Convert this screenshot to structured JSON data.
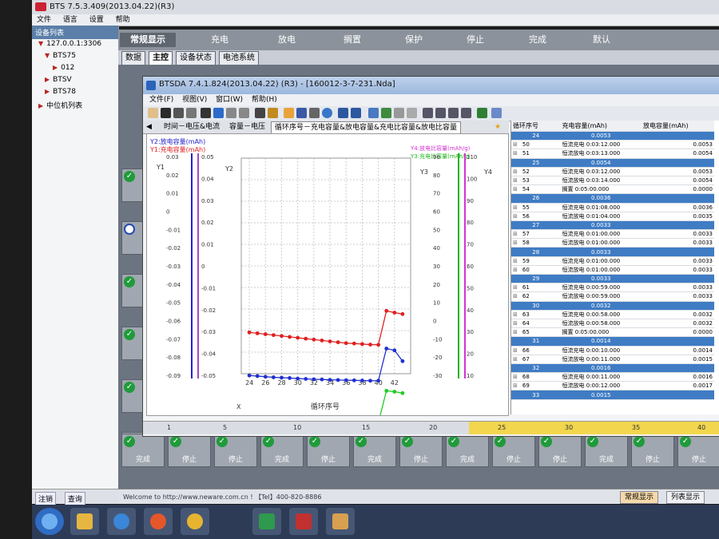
{
  "app": {
    "title": "BTS 7.5.3.409(2013.04.22)(R3)",
    "menu": [
      "文件",
      "语言",
      "设置",
      "帮助"
    ],
    "tree_header": "设备列表",
    "tree": [
      {
        "label": "127.0.0.1:3306",
        "level": 0
      },
      {
        "label": "BTS75",
        "level": 1
      },
      {
        "label": "012",
        "level": 2
      },
      {
        "label": "BTSV",
        "level": 1
      },
      {
        "label": "BTS78",
        "level": 1
      },
      {
        "label": "中位机列表",
        "level": 0
      }
    ],
    "tree_buttons": [
      "注销",
      "查询"
    ],
    "top_tabs": [
      "常规显示",
      "充电",
      "放电",
      "搁置",
      "保护",
      "停止",
      "完成",
      "默认"
    ],
    "sub_tabs": [
      "数据",
      "主控",
      "设备状态",
      "电池系统"
    ],
    "channel_labels": [
      "完成",
      "停止",
      "停止",
      "完成",
      "停止",
      "完成",
      "停止",
      "完成",
      "停止",
      "停止",
      "完成",
      "停止",
      "停止"
    ],
    "status_welcome": "Welcome to http://www.neware.com.cn ! 【Tel】400-820-8886",
    "status_buttons": [
      "常规显示",
      "列表显示"
    ]
  },
  "btsda": {
    "title": "BTSDA 7.4.1.824(2013.04.22) (R3) - [160012-3-7-231.Nda]",
    "menu": [
      "文件(F)",
      "视图(V)",
      "窗口(W)",
      "帮助(H)"
    ],
    "tabs": [
      "时间－电压&电流",
      "容量－电压",
      "循环序号－充电容量&放电容量&充电比容量&放电比容量"
    ],
    "bottom_ticks": [
      "1",
      "5",
      "10",
      "15",
      "20",
      "25",
      "30",
      "35",
      "40"
    ]
  },
  "chart_data": {
    "type": "line",
    "legend_left": [
      "Y2:放电容量(mAh)",
      "Y1:充电容量(mAh)"
    ],
    "legend_right": [
      "Y4:放电比容量(mAh/g)",
      "Y3:充电比容量(mAh/g)"
    ],
    "xlabel": "循环序号",
    "x_axis_letter": "X",
    "axis_names": {
      "y1": "Y1",
      "y2": "Y2",
      "y3": "Y3",
      "y4": "Y4"
    },
    "xlim": [
      23,
      44
    ],
    "x_ticks": [
      24,
      26,
      28,
      30,
      32,
      34,
      36,
      38,
      40,
      42
    ],
    "y1": {
      "ticks": [
        "0.03",
        "0.02",
        "0.01",
        "0",
        "-0.01",
        "-0.02",
        "-0.03",
        "-0.04",
        "-0.05",
        "-0.06",
        "-0.07",
        "-0.08",
        "-0.09"
      ],
      "color": "#2222cc"
    },
    "y2": {
      "ticks": [
        "0.05",
        "0.04",
        "0.03",
        "0.02",
        "0.01",
        "0",
        "-0.01",
        "-0.02",
        "-0.03",
        "-0.04",
        "-0.05"
      ],
      "color": "#a646c9"
    },
    "y3": {
      "ticks": [
        "90",
        "80",
        "70",
        "60",
        "50",
        "40",
        "30",
        "20",
        "10",
        "0",
        "-10",
        "-20",
        "-30"
      ],
      "color": "#1bb51b"
    },
    "y4": {
      "ticks": [
        "110",
        "100",
        "90",
        "80",
        "70",
        "60",
        "50",
        "40",
        "30",
        "20",
        "10"
      ],
      "color": "#d233d2"
    },
    "x": [
      24,
      25,
      26,
      27,
      28,
      29,
      30,
      31,
      32,
      33,
      34,
      35,
      36,
      37,
      38,
      39,
      40,
      41,
      42,
      43
    ],
    "series": [
      {
        "color": "#e02020",
        "values": [
          -7,
          -7.5,
          -8,
          -8.5,
          -9,
          -9.5,
          -10,
          -10.5,
          -11,
          -11.5,
          -12,
          -12.5,
          -13,
          -13.2,
          -13.5,
          -13.8,
          -13.9,
          5,
          4,
          3.2
        ]
      },
      {
        "color": "#2030d0",
        "values": [
          -31,
          -31.3,
          -31.7,
          -32,
          -32.2,
          -32.4,
          -32.7,
          -32.9,
          -33.1,
          -33.2,
          -33.4,
          -33.5,
          -33.6,
          -33.7,
          -33.8,
          -33.9,
          -33.9,
          -16,
          -17,
          -23
        ]
      },
      {
        "color": "#22cc22",
        "values": [
          -55,
          -55.3,
          -55.6,
          -55.9,
          -56.1,
          -56.2,
          -56.4,
          -56.5,
          -56.6,
          -56.7,
          -56.8,
          -56.9,
          -57,
          -57,
          -57.1,
          -57.2,
          -57.2,
          -39.5,
          -40,
          -40.8
        ]
      },
      {
        "color": "#e040d0",
        "values": [
          -79,
          -79.5,
          -79.9,
          -80.1,
          -80.3,
          -80.5,
          -80.7,
          -80.9,
          -81,
          -81.1,
          -81.2,
          -81.3,
          -81.4,
          -81.5,
          -81.6,
          -81.6,
          -81.7,
          -62,
          -63.5,
          -70
        ]
      }
    ]
  },
  "grid": {
    "headers": [
      "循环序号",
      "充电容量(mAh)",
      "放电容量(mAh)"
    ],
    "rows": [
      {
        "type": "group",
        "id": "24",
        "value": "0.0053"
      },
      {
        "type": "row",
        "n": "50",
        "step": "恒流充电",
        "time": "0:03:12.000",
        "val": "0.0053"
      },
      {
        "type": "row",
        "n": "51",
        "step": "恒流放电",
        "time": "0:03:13.000",
        "val": "0.0054"
      },
      {
        "type": "group",
        "id": "25",
        "value": "0.0054"
      },
      {
        "type": "row",
        "n": "52",
        "step": "恒流充电",
        "time": "0:03:12.000",
        "val": "0.0053"
      },
      {
        "type": "row",
        "n": "53",
        "step": "恒流放电",
        "time": "0:03:14.000",
        "val": "0.0054"
      },
      {
        "type": "row",
        "n": "54",
        "step": "搁置",
        "time": "0:05:00.000",
        "val": "0.0000"
      },
      {
        "type": "group",
        "id": "26",
        "value": "0.0036"
      },
      {
        "type": "row",
        "n": "55",
        "step": "恒流充电",
        "time": "0:01:08.000",
        "val": "0.0036"
      },
      {
        "type": "row",
        "n": "56",
        "step": "恒流放电",
        "time": "0:01:04.000",
        "val": "0.0035"
      },
      {
        "type": "group",
        "id": "27",
        "value": "0.0033"
      },
      {
        "type": "row",
        "n": "57",
        "step": "恒流充电",
        "time": "0:01:00.000",
        "val": "0.0033"
      },
      {
        "type": "row",
        "n": "58",
        "step": "恒流放电",
        "time": "0:01:00.000",
        "val": "0.0033"
      },
      {
        "type": "group",
        "id": "28",
        "value": "0.0033"
      },
      {
        "type": "row",
        "n": "59",
        "step": "恒流充电",
        "time": "0:01:00.000",
        "val": "0.0033"
      },
      {
        "type": "row",
        "n": "60",
        "step": "恒流放电",
        "time": "0:01:00.000",
        "val": "0.0033"
      },
      {
        "type": "group",
        "id": "29",
        "value": "0.0033"
      },
      {
        "type": "row",
        "n": "61",
        "step": "恒流充电",
        "time": "0:00:59.000",
        "val": "0.0033"
      },
      {
        "type": "row",
        "n": "62",
        "step": "恒流放电",
        "time": "0:00:59.000",
        "val": "0.0033"
      },
      {
        "type": "group",
        "id": "30",
        "value": "0.0032"
      },
      {
        "type": "row",
        "n": "63",
        "step": "恒流充电",
        "time": "0:00:58.000",
        "val": "0.0032"
      },
      {
        "type": "row",
        "n": "64",
        "step": "恒流放电",
        "time": "0:00:58.000",
        "val": "0.0032"
      },
      {
        "type": "row",
        "n": "65",
        "step": "搁置",
        "time": "0:05:00.000",
        "val": "0.0000"
      },
      {
        "type": "group",
        "id": "31",
        "value": "0.0014"
      },
      {
        "type": "row",
        "n": "66",
        "step": "恒流充电",
        "time": "0:00:10.000",
        "val": "0.0014"
      },
      {
        "type": "row",
        "n": "67",
        "step": "恒流放电",
        "time": "0:00:11.000",
        "val": "0.0015"
      },
      {
        "type": "group",
        "id": "32",
        "value": "0.0016"
      },
      {
        "type": "row",
        "n": "68",
        "step": "恒流充电",
        "time": "0:00:11.000",
        "val": "0.0016"
      },
      {
        "type": "row",
        "n": "69",
        "step": "恒流放电",
        "time": "0:00:12.000",
        "val": "0.0017"
      },
      {
        "type": "group",
        "id": "33",
        "value": "0.0015"
      }
    ]
  }
}
